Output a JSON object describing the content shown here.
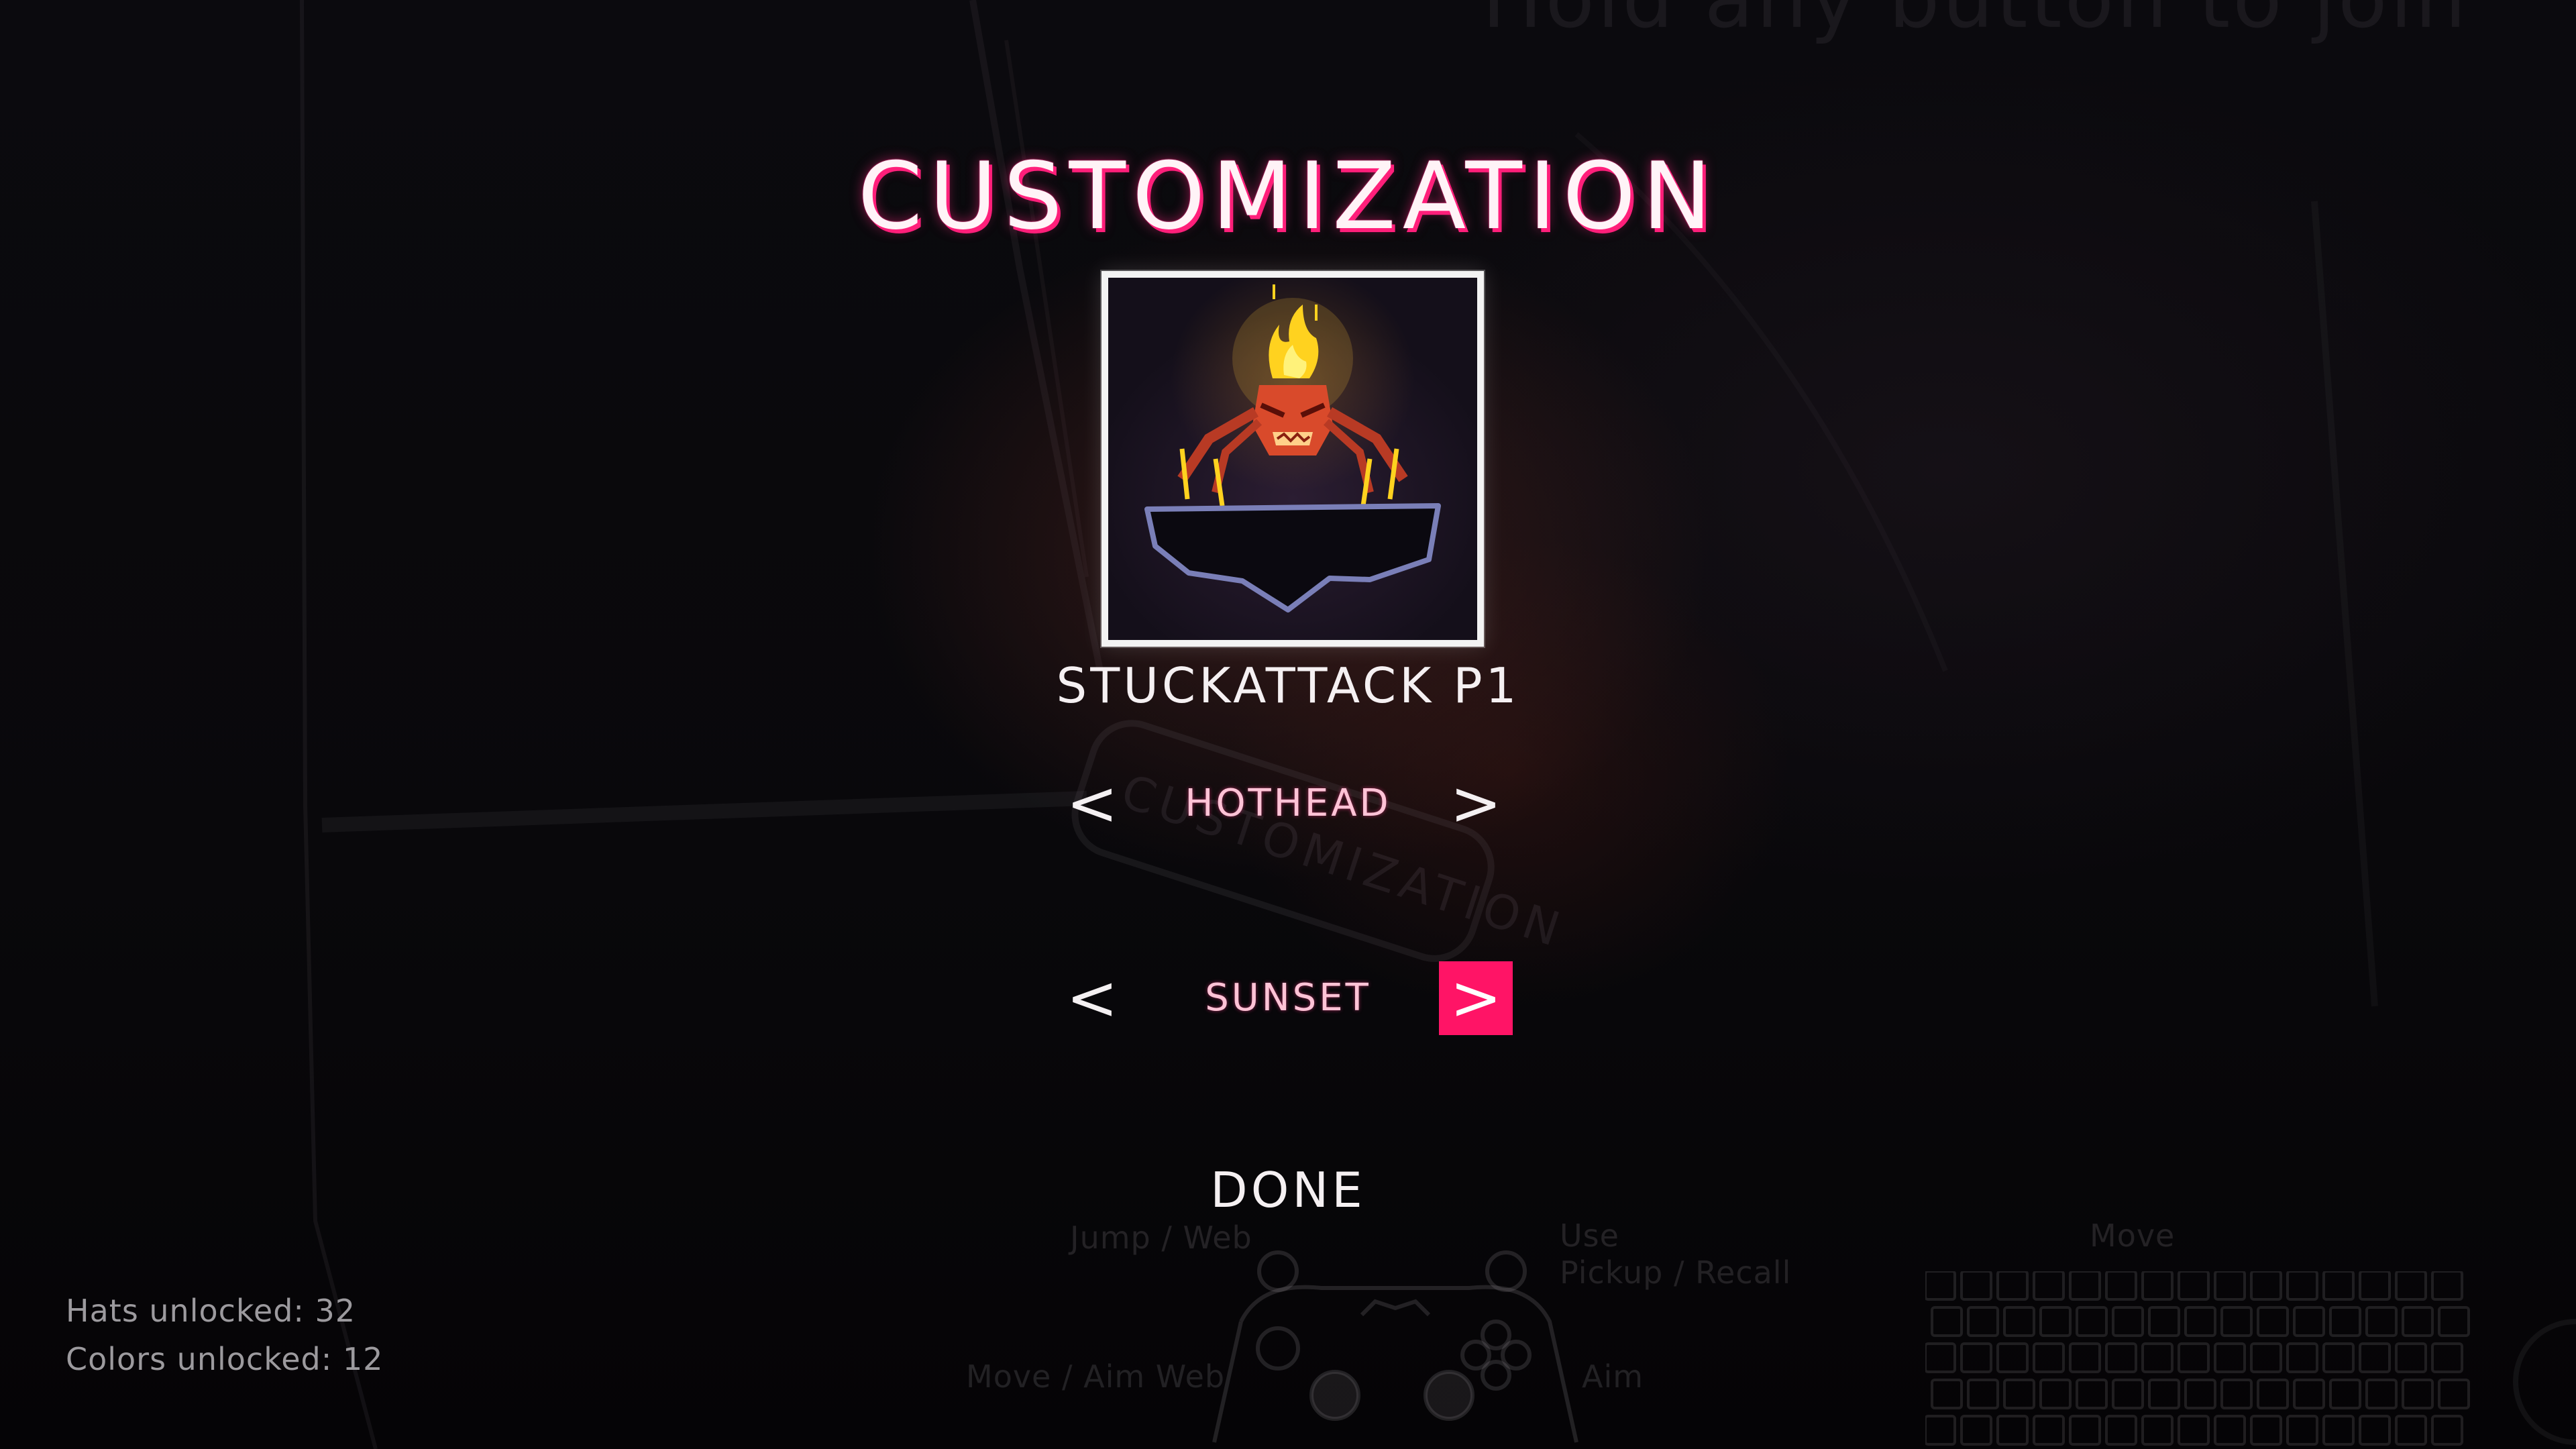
{
  "background": {
    "join_hint": "Hold any button to join"
  },
  "title": "CUSTOMIZATION",
  "player": {
    "name": "STUCKATTACK P1"
  },
  "hat_selector": {
    "prev_label": "<",
    "value": "HOTHEAD",
    "next_label": ">"
  },
  "color_selector": {
    "prev_label": "<",
    "value": "SUNSET",
    "next_label": ">"
  },
  "done_label": "DONE",
  "stats": {
    "hats_unlocked": "Hats unlocked: 32",
    "colors_unlocked": "Colors unlocked: 12"
  },
  "controls_hint": {
    "jump_web": "Jump / Web",
    "use": "Use",
    "pickup_recall": "Pickup / Recall",
    "move_aim_web": "Move / Aim Web",
    "aim": "Aim",
    "move": "Move"
  },
  "colors": {
    "accent": "#ff1466",
    "title_glow": "#ff1f7a",
    "value_text": "#ffc3d6"
  }
}
